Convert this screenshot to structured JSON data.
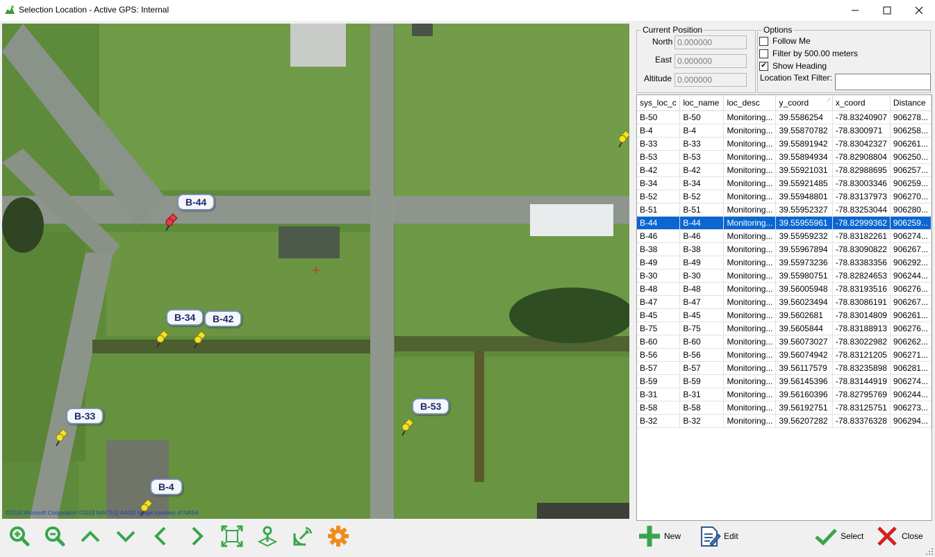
{
  "window": {
    "title": "Selection Location - Active GPS: Internal",
    "controls": [
      "minimize",
      "maximize",
      "close"
    ]
  },
  "map": {
    "copyright": "©2018 Microsoft Corporation ©2018 NAVTEQ ©AND Image courtesy of NASA",
    "markers": [
      {
        "label": "B-44",
        "color": "#e23b4a",
        "selected": true
      },
      {
        "label": "B-34",
        "color": "#f2e22a",
        "selected": false
      },
      {
        "label": "B-42",
        "color": "#f2e22a",
        "selected": false
      },
      {
        "label": "B-33",
        "color": "#f2e22a",
        "selected": false
      },
      {
        "label": "B-53",
        "color": "#f2e22a",
        "selected": false
      },
      {
        "label": "B-4",
        "color": "#f2e22a",
        "selected": false
      }
    ]
  },
  "current_position": {
    "legend": "Current Position",
    "north_label": "North",
    "north_value": "0.000000",
    "east_label": "East",
    "east_value": "0.000000",
    "altitude_label": "Altitude",
    "altitude_value": "0.000000"
  },
  "options": {
    "legend": "Options",
    "follow_me": {
      "label": "Follow Me",
      "checked": false
    },
    "filter_by": {
      "label": "Filter by 500.00 meters",
      "checked": false
    },
    "show_heading": {
      "label": "Show Heading",
      "checked": true
    },
    "location_text_filter_label": "Location Text Filter:",
    "location_text_filter_value": ""
  },
  "grid": {
    "columns": [
      "sys_loc_c",
      "loc_name",
      "loc_desc",
      "y_coord",
      "x_coord",
      "Distance"
    ],
    "sorted_column": "y_coord",
    "selected_row": 8,
    "rows": [
      [
        "B-50",
        "B-50",
        "Monitoring...",
        "39.5586254",
        "-78.83240907",
        "906278..."
      ],
      [
        "B-4",
        "B-4",
        "Monitoring...",
        "39.55870782",
        "-78.8300971",
        "906258..."
      ],
      [
        "B-33",
        "B-33",
        "Monitoring...",
        "39.55891942",
        "-78.83042327",
        "906261..."
      ],
      [
        "B-53",
        "B-53",
        "Monitoring...",
        "39.55894934",
        "-78.82908804",
        "906250..."
      ],
      [
        "B-42",
        "B-42",
        "Monitoring...",
        "39.55921031",
        "-78.82988695",
        "906257..."
      ],
      [
        "B-34",
        "B-34",
        "Monitoring...",
        "39.55921485",
        "-78.83003346",
        "906259..."
      ],
      [
        "B-52",
        "B-52",
        "Monitoring...",
        "39.55948801",
        "-78.83137973",
        "906270..."
      ],
      [
        "B-51",
        "B-51",
        "Monitoring...",
        "39.55952327",
        "-78.83253044",
        "906280..."
      ],
      [
        "B-44",
        "B-44",
        "Monitoring...",
        "39.55955961",
        "-78.82999362",
        "906259..."
      ],
      [
        "B-46",
        "B-46",
        "Monitoring...",
        "39.55959232",
        "-78.83182261",
        "906274..."
      ],
      [
        "B-38",
        "B-38",
        "Monitoring...",
        "39.55967894",
        "-78.83090822",
        "906267..."
      ],
      [
        "B-49",
        "B-49",
        "Monitoring...",
        "39.55973236",
        "-78.83383356",
        "906292..."
      ],
      [
        "B-30",
        "B-30",
        "Monitoring...",
        "39.55980751",
        "-78.82824653",
        "906244..."
      ],
      [
        "B-48",
        "B-48",
        "Monitoring...",
        "39.56005948",
        "-78.83193516",
        "906276..."
      ],
      [
        "B-47",
        "B-47",
        "Monitoring...",
        "39.56023494",
        "-78.83086191",
        "906267..."
      ],
      [
        "B-45",
        "B-45",
        "Monitoring...",
        "39.5602681",
        "-78.83014809",
        "906261..."
      ],
      [
        "B-75",
        "B-75",
        "Monitoring...",
        "39.5605844",
        "-78.83188913",
        "906276..."
      ],
      [
        "B-60",
        "B-60",
        "Monitoring...",
        "39.56073027",
        "-78.83022982",
        "906262..."
      ],
      [
        "B-56",
        "B-56",
        "Monitoring...",
        "39.56074942",
        "-78.83121205",
        "906271..."
      ],
      [
        "B-57",
        "B-57",
        "Monitoring...",
        "39.56117579",
        "-78.83235898",
        "906281..."
      ],
      [
        "B-59",
        "B-59",
        "Monitoring...",
        "39.56145396",
        "-78.83144919",
        "906274..."
      ],
      [
        "B-31",
        "B-31",
        "Monitoring...",
        "39.56160396",
        "-78.82795769",
        "906244..."
      ],
      [
        "B-58",
        "B-58",
        "Monitoring...",
        "39.56192751",
        "-78.83125751",
        "906273..."
      ],
      [
        "B-32",
        "B-32",
        "Monitoring...",
        "39.56207282",
        "-78.83376328",
        "906294..."
      ]
    ]
  },
  "toolbar": {
    "icons": [
      "zoom-in-icon",
      "zoom-out-icon",
      "pan-up-icon",
      "pan-down-icon",
      "pan-left-icon",
      "pan-right-icon",
      "zoom-extents-icon",
      "my-location-icon",
      "gps-satellite-icon",
      "settings-gear-icon"
    ],
    "accent": "#37a64a",
    "gear_color": "#f08c1c"
  },
  "actions": {
    "new_label": "New",
    "edit_label": "Edit",
    "select_label": "Select",
    "close_label": "Close"
  }
}
